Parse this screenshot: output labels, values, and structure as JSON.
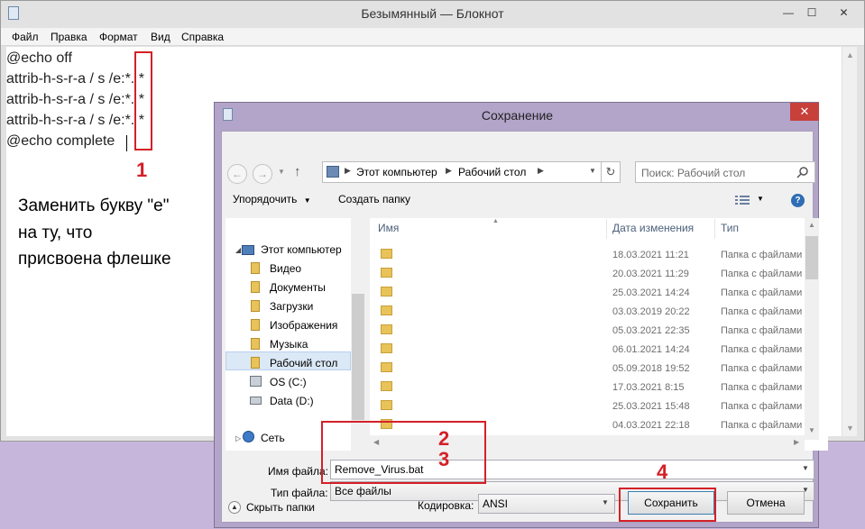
{
  "notepad": {
    "title": "Безымянный — Блокнот",
    "menu": [
      "Файл",
      "Правка",
      "Формат",
      "Вид",
      "Справка"
    ],
    "lines": [
      "@echo off",
      "attrib-h-s-r-a / s /e:*. *",
      "attrib-h-s-r-a / s /e:*. *",
      "attrib-h-s-r-a / s /e:*. *",
      "@echo complete"
    ],
    "controls": {
      "minimize": "—",
      "maximize": "☐",
      "close": "✕"
    }
  },
  "annotation": {
    "hint_lines": [
      "Заменить букву \"e\"",
      "на ту, что",
      "присвоена флешке"
    ],
    "markers": [
      "1",
      "2",
      "3",
      "4"
    ],
    "color": "#d42027"
  },
  "dialog": {
    "title": "Сохранение",
    "close": "✕",
    "address_path": [
      "Этот компьютер",
      "Рабочий стол"
    ],
    "search_placeholder": "Поиск: Рабочий стол",
    "toolbar": {
      "organize": "Упорядочить",
      "new_folder": "Создать папку"
    },
    "tree": [
      {
        "label": "Этот компьютер",
        "icon": "computer-icon"
      },
      {
        "label": "Видео",
        "icon": "folder-icon"
      },
      {
        "label": "Документы",
        "icon": "folder-icon"
      },
      {
        "label": "Загрузки",
        "icon": "folder-icon"
      },
      {
        "label": "Изображения",
        "icon": "folder-icon"
      },
      {
        "label": "Музыка",
        "icon": "folder-icon"
      },
      {
        "label": "Рабочий стол",
        "icon": "folder-icon",
        "selected": true
      },
      {
        "label": "OS (C:)",
        "icon": "drive-icon"
      },
      {
        "label": "Data (D:)",
        "icon": "drive-icon"
      },
      {
        "label": "Сеть",
        "icon": "network-icon"
      }
    ],
    "columns": [
      "Имя",
      "Дата изменения",
      "Тип"
    ],
    "rows": [
      {
        "date": "18.03.2021 11:21",
        "type": "Папка с файлами"
      },
      {
        "date": "20.03.2021 11:29",
        "type": "Папка с файлами"
      },
      {
        "date": "25.03.2021 14:24",
        "type": "Папка с файлами"
      },
      {
        "date": "03.03.2019 20:22",
        "type": "Папка с файлами"
      },
      {
        "date": "05.03.2021 22:35",
        "type": "Папка с файлами"
      },
      {
        "date": "06.01.2021 14:24",
        "type": "Папка с файлами"
      },
      {
        "date": "05.09.2018 19:52",
        "type": "Папка с файлами"
      },
      {
        "date": "17.03.2021 8:15",
        "type": "Папка с файлами"
      },
      {
        "date": "25.03.2021 15:48",
        "type": "Папка с файлами"
      },
      {
        "date": "04.03.2021 22:18",
        "type": "Папка с файлами"
      }
    ],
    "filename_label": "Имя файла:",
    "filename_value": "Remove_Virus.bat",
    "filetype_label": "Тип файла:",
    "filetype_value": "Все файлы",
    "hide_folders": "Скрыть папки",
    "encoding_label": "Кодировка:",
    "encoding_value": "ANSI",
    "save_button": "Сохранить",
    "cancel_button": "Отмена"
  }
}
